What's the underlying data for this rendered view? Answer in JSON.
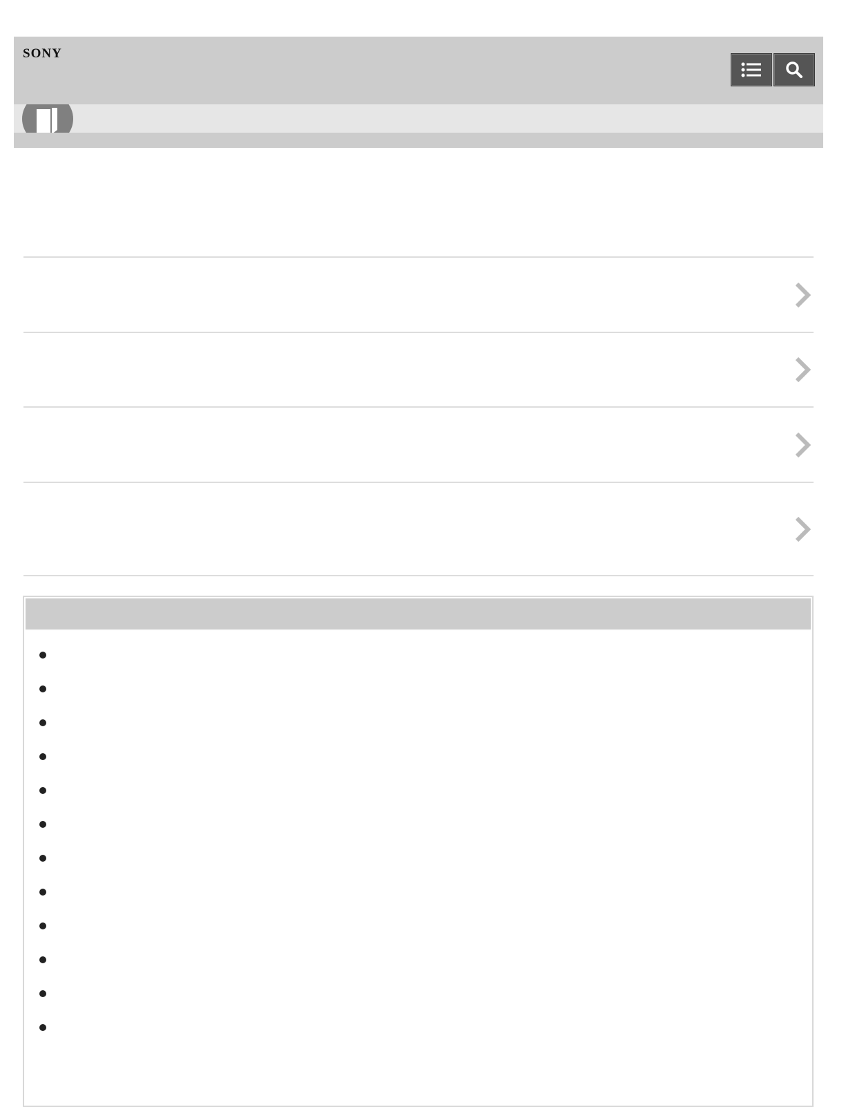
{
  "header": {
    "logo": "SONY",
    "buttons": [
      {
        "icon": "list-icon"
      },
      {
        "icon": "search-icon"
      }
    ],
    "badge_icon": "book-icon"
  },
  "nav_rows": [
    {
      "label": "",
      "icon": "chevron-right-icon"
    },
    {
      "label": "",
      "icon": "chevron-right-icon"
    },
    {
      "label": "",
      "icon": "chevron-right-icon"
    },
    {
      "label": "",
      "icon": "chevron-right-icon"
    }
  ],
  "panel": {
    "title": "",
    "items": [
      "",
      "",
      "",
      "",
      "",
      "",
      "",
      "",
      "",
      "",
      "",
      ""
    ]
  },
  "colors": {
    "header_bg": "#cccccc",
    "subbar_bg": "#e6e6e6",
    "button_bg": "#555555",
    "chevron": "#bbbbbb",
    "divider": "#dddddd"
  }
}
